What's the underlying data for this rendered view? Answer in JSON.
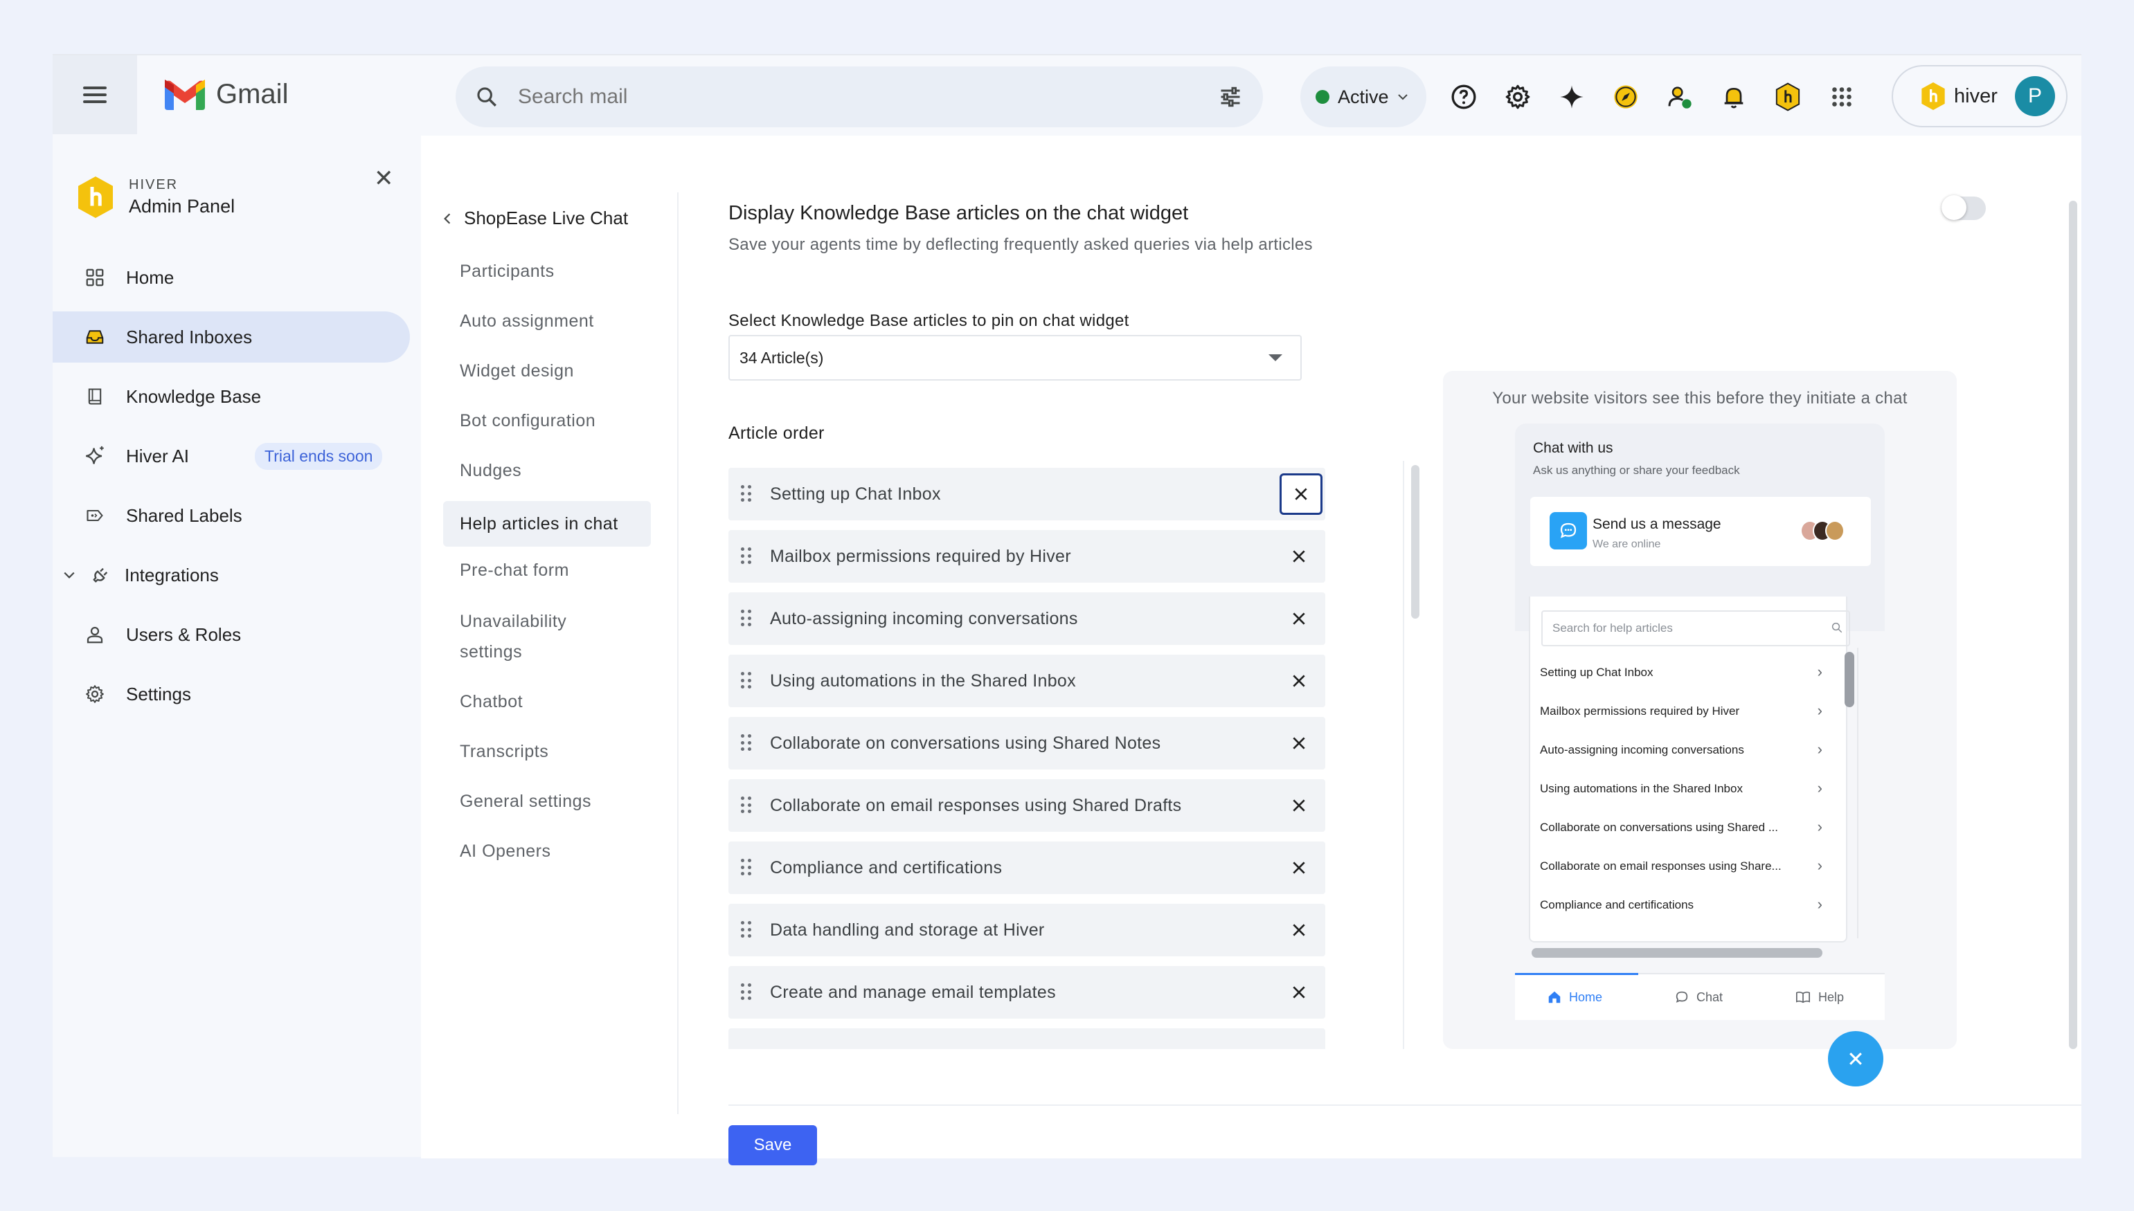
{
  "topbar": {
    "app_name": "Gmail",
    "search_placeholder": "Search mail",
    "status_label": "Active",
    "account_brand": "hiver",
    "avatar_initial": "P"
  },
  "leftnav": {
    "brand_small": "HIVER",
    "brand_title": "Admin Panel",
    "items": [
      {
        "label": "Home",
        "icon": "grid-icon"
      },
      {
        "label": "Shared Inboxes",
        "icon": "inbox-icon",
        "active": true
      },
      {
        "label": "Knowledge Base",
        "icon": "book-icon"
      },
      {
        "label": "Hiver AI",
        "icon": "sparkle-icon",
        "badge": "Trial ends soon"
      },
      {
        "label": "Shared Labels",
        "icon": "label-icon"
      },
      {
        "label": "Integrations",
        "icon": "plug-icon"
      },
      {
        "label": "Users & Roles",
        "icon": "user-icon"
      },
      {
        "label": "Settings",
        "icon": "gear-icon"
      }
    ]
  },
  "subnav": {
    "back_label": "ShopEase Live Chat",
    "items": [
      {
        "label": "Participants"
      },
      {
        "label": "Auto assignment"
      },
      {
        "label": "Widget design"
      },
      {
        "label": "Bot configuration"
      },
      {
        "label": "Nudges"
      },
      {
        "label": "Help articles in chat",
        "active": true
      },
      {
        "label": "Pre-chat form"
      },
      {
        "label": "Unavailability",
        "label2": "settings"
      },
      {
        "label": "Chatbot"
      },
      {
        "label": "Transcripts"
      },
      {
        "label": "General settings"
      },
      {
        "label": "AI Openers"
      }
    ]
  },
  "content": {
    "title": "Display Knowledge Base articles on the chat widget",
    "subtitle": "Save your agents time by deflecting frequently asked queries via help articles",
    "toggle_on": false,
    "select_label": "Select Knowledge Base articles to pin on chat widget",
    "select_value": "34 Article(s)",
    "order_label": "Article order",
    "articles": [
      "Setting up Chat Inbox",
      "Mailbox permissions required by Hiver",
      "Auto-assigning incoming conversations",
      "Using automations in the Shared Inbox",
      "Collaborate on conversations using Shared Notes",
      "Collaborate on email responses using Shared Drafts",
      "Compliance and certifications",
      "Data handling and storage at Hiver",
      "Create and manage email templates"
    ],
    "save_label": "Save"
  },
  "preview": {
    "caption": "Your website visitors see this before they initiate a chat",
    "widget_title": "Chat with us",
    "widget_subtitle": "Ask us anything or share your feedback",
    "card_title": "Send us a message",
    "card_subtitle": "We are online",
    "search_placeholder": "Search for help articles",
    "rows": [
      "Setting up Chat Inbox",
      "Mailbox permissions required by Hiver",
      "Auto-assigning incoming conversations",
      "Using automations in the Shared Inbox",
      "Collaborate on conversations using Shared ...",
      "Collaborate on email responses using Share...",
      "Compliance and certifications"
    ],
    "tabs": [
      "Home",
      "Chat",
      "Help"
    ]
  },
  "colors": {
    "accent": "#3d63f2",
    "active_nav": "#dde5f7",
    "widget_blue": "#2aa2ef"
  }
}
